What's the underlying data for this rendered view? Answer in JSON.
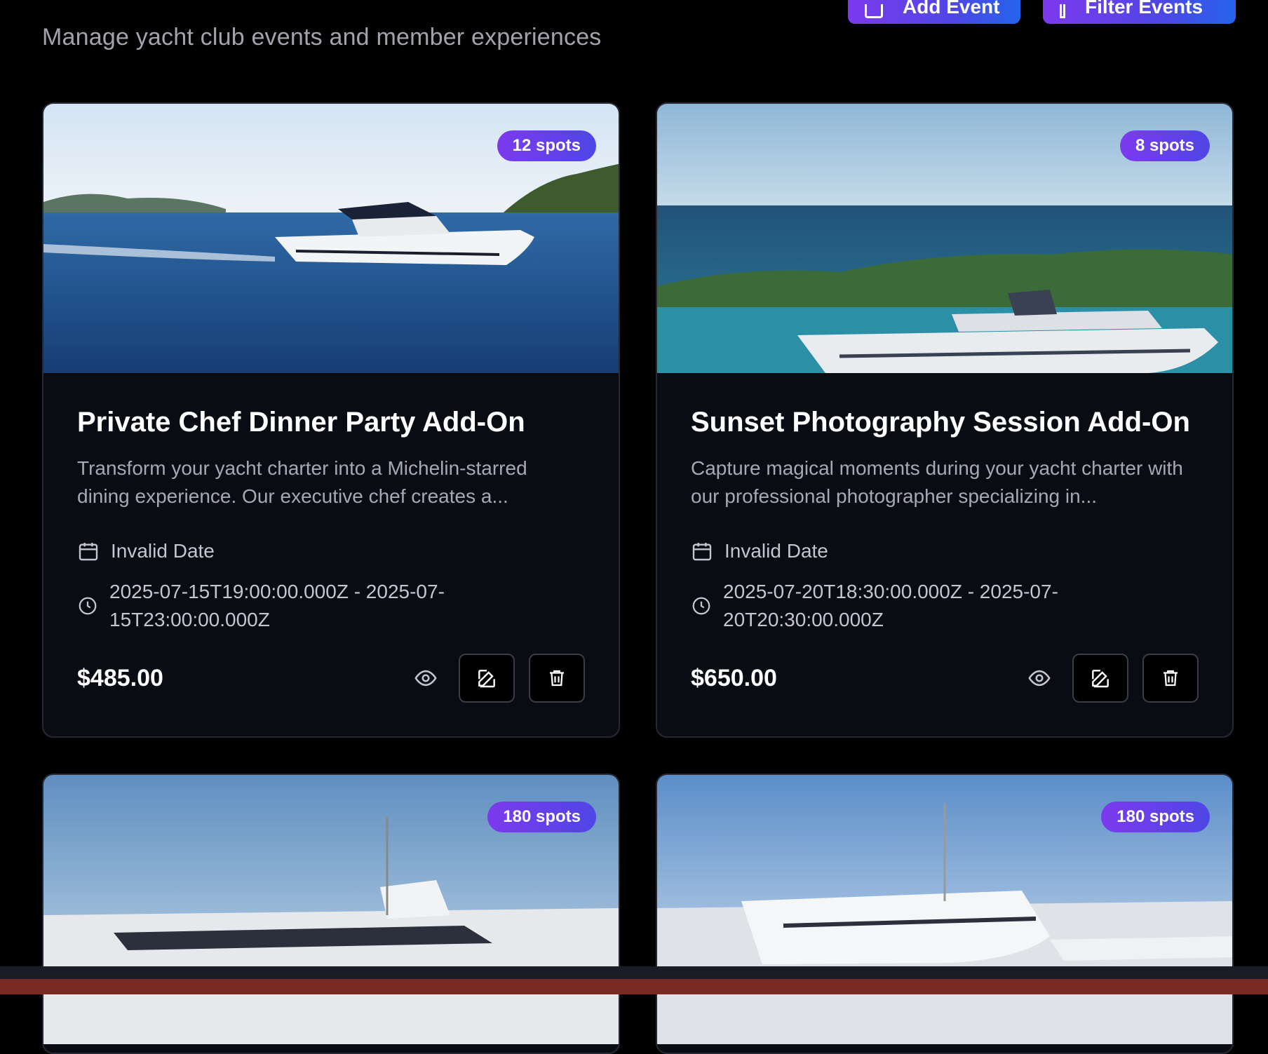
{
  "header": {
    "subtitle": "Manage yacht club events and member experiences",
    "add_event_label": "Add Event",
    "filter_events_label": "Filter Events"
  },
  "cards": [
    {
      "badge": "12 spots",
      "title": "Private Chef Dinner Party Add-On",
      "description": "Transform your yacht charter into a Michelin-starred dining experience. Our executive chef creates a...",
      "date": "Invalid Date",
      "time": "2025-07-15T19:00:00.000Z - 2025-07-15T23:00:00.000Z",
      "price": "$485.00"
    },
    {
      "badge": "8 spots",
      "title": "Sunset Photography Session Add-On",
      "description": "Capture magical moments during your yacht charter with our professional photographer specializing in...",
      "date": "Invalid Date",
      "time": "2025-07-20T18:30:00.000Z - 2025-07-20T20:30:00.000Z",
      "price": "$650.00"
    },
    {
      "badge": "180 spots"
    },
    {
      "badge": "180 spots"
    }
  ],
  "colors": {
    "accent_gradient_start": "#7c3aed",
    "accent_gradient_end": "#4f46e5",
    "card_bg": "#0a0c14",
    "page_bg": "#000000"
  }
}
